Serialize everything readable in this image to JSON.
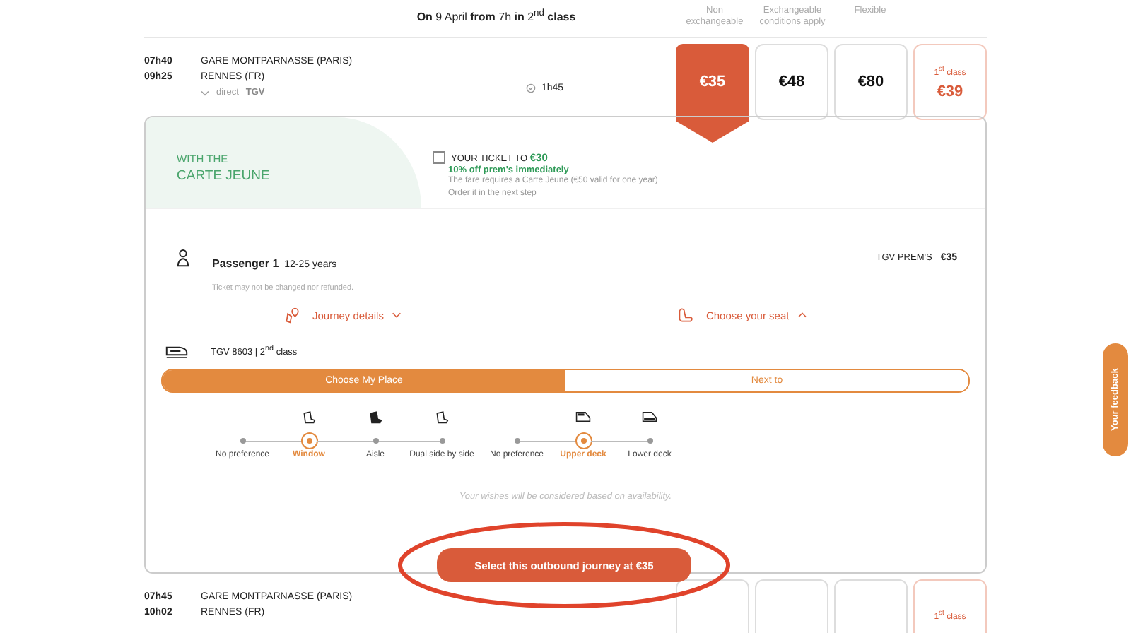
{
  "header": {
    "summary": "**On** 9 April **from** 7h **in** 2$^{nd}$ **class**",
    "fare_columns": [
      "Non exchangeable",
      "Exchangeable conditions apply",
      "Flexible"
    ]
  },
  "journeys": [
    {
      "depart_time": "07h40",
      "arrive_time": "09h25",
      "origin": "GARE MONTPARNASSE (PARIS)",
      "destination": "RENNES (FR)",
      "stops": "direct",
      "train": "TGV",
      "duration": "1h45",
      "expanded": true,
      "fares": [
        {
          "price": "€35",
          "selected": true
        },
        {
          "price": "€48",
          "selected": false
        },
        {
          "price": "€80",
          "selected": false
        }
      ],
      "first_class": {
        "label": "1$^{st}$ class",
        "price": "€39"
      }
    },
    {
      "depart_time": "07h45",
      "arrive_time": "10h02",
      "origin": "GARE MONTPARNASSE (PARIS)",
      "destination": "RENNES (FR)",
      "expanded": false,
      "fares": [
        {
          "selected": false
        },
        {
          "selected": false
        },
        {
          "selected": false
        }
      ],
      "first_class": {
        "label": "1$^{st}$ class"
      }
    }
  ],
  "offer": {
    "title_lines": [
      "WITH THE",
      "CARTE JEUNE"
    ],
    "checked": false,
    "headline": "YOUR TICKET TO **€30**",
    "subline": "10% off prem's immediately",
    "notes": [
      "The fare requires a Carte Jeune (€50 valid for one year)",
      "Order it in the next step"
    ]
  },
  "passenger": {
    "label": "Passenger 1",
    "age": "12-25 years",
    "note": "Ticket may not be changed nor refunded.",
    "fare_name": "TGV PREM'S",
    "fare_price": "€35"
  },
  "links": [
    {
      "label": "Journey details",
      "expanded": false
    },
    {
      "label": "Choose your seat",
      "expanded": true
    }
  ],
  "train_info": "TGV 8603 | 2$^{nd}$ class",
  "seat_modes": [
    {
      "label": "Choose My Place",
      "selected": true
    },
    {
      "label": "Next to",
      "selected": false
    }
  ],
  "seat_groups": [
    {
      "options": [
        {
          "label": "No preference",
          "selected": false
        },
        {
          "label": "Window",
          "selected": true
        },
        {
          "label": "Aisle",
          "selected": false
        },
        {
          "label": "Dual side by side",
          "selected": false
        }
      ]
    },
    {
      "options": [
        {
          "label": "No preference",
          "selected": false
        },
        {
          "label": "Upper deck",
          "selected": true
        },
        {
          "label": "Lower deck",
          "selected": false
        }
      ]
    }
  ],
  "availability_note": "Your wishes will be considered based on availability.",
  "select_button": "Select this outbound journey at €35",
  "feedback_tab": "Your feedback"
}
